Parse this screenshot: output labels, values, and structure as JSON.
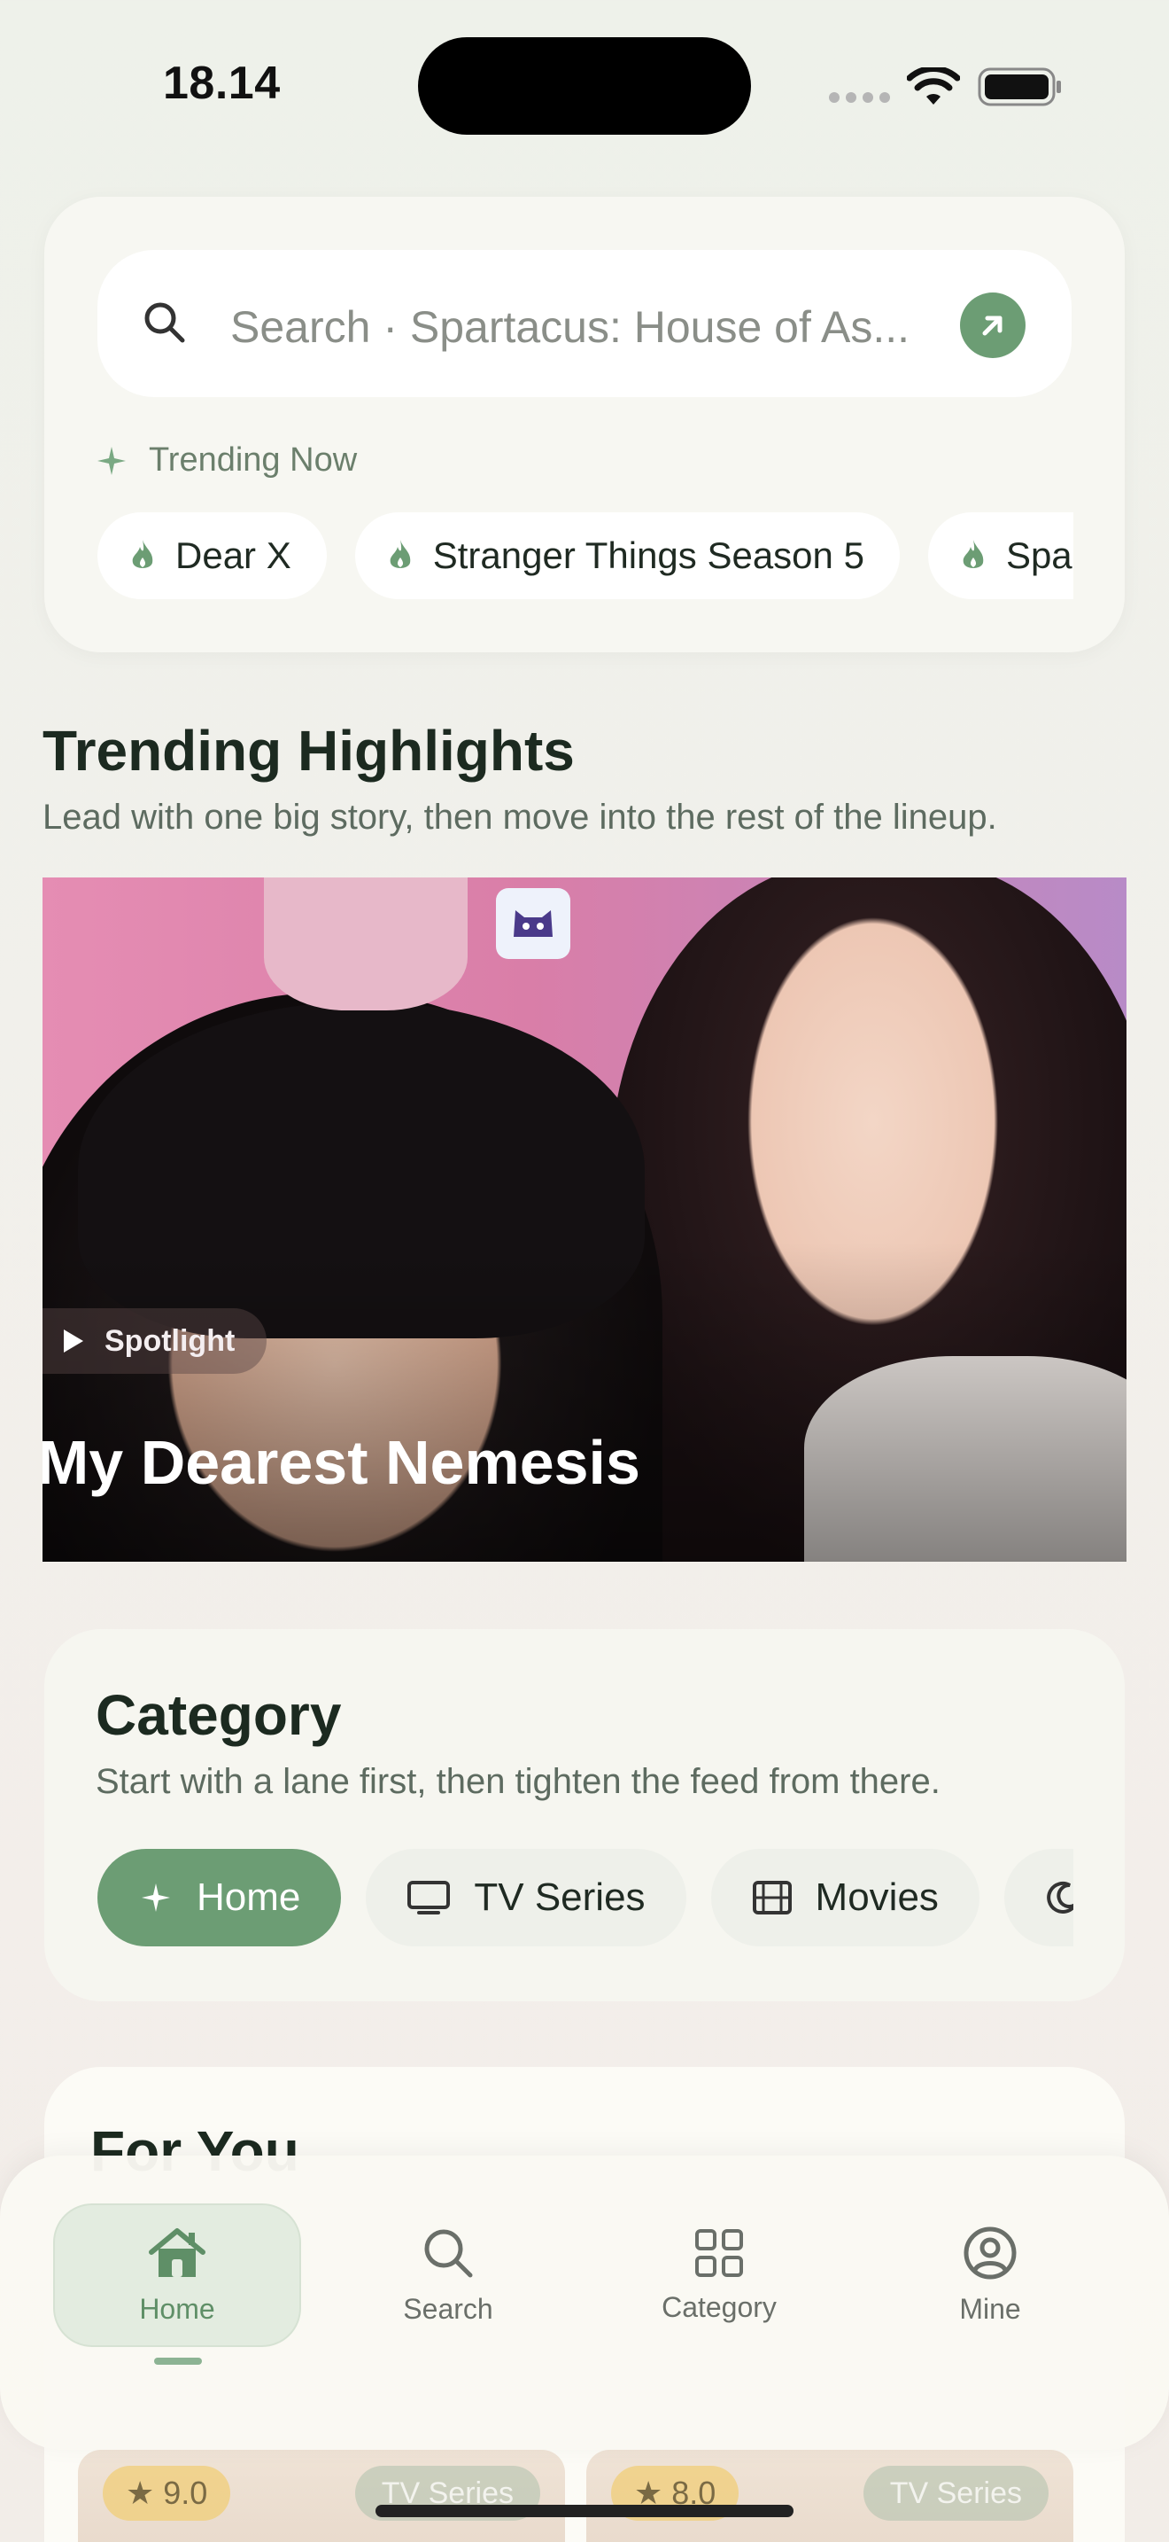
{
  "status_bar": {
    "time": "18.14"
  },
  "search": {
    "placeholder": "Search · Spartacus: House of As...",
    "trending_label": "Trending Now",
    "trending_chips": [
      "Dear X",
      "Stranger Things Season 5",
      "Spartacus"
    ]
  },
  "highlights": {
    "title": "Trending Highlights",
    "subtitle": "Lead with one big story, then move into the rest of the lineup.",
    "hero": {
      "badge": "Spotlight",
      "title": "My Dearest Nemesis"
    }
  },
  "category": {
    "title": "Category",
    "subtitle": "Start with a lane first, then tighten the feed from there.",
    "chips": [
      {
        "label": "Home",
        "icon": "sparkle-icon",
        "active": true
      },
      {
        "label": "TV Series",
        "icon": "tv-icon",
        "active": false
      },
      {
        "label": "Movies",
        "icon": "film-icon",
        "active": false
      },
      {
        "label": "",
        "icon": "moon-icon",
        "active": false
      }
    ]
  },
  "for_you": {
    "title": "For You",
    "items": [
      {
        "rating": "9.0",
        "type": "TV Series"
      },
      {
        "rating": "8.0",
        "type": "TV Series"
      }
    ]
  },
  "tabbar": {
    "tabs": [
      {
        "label": "Home",
        "icon": "home-icon",
        "active": true
      },
      {
        "label": "Search",
        "icon": "search-icon",
        "active": false
      },
      {
        "label": "Category",
        "icon": "grid-icon",
        "active": false
      },
      {
        "label": "Mine",
        "icon": "profile-icon",
        "active": false
      }
    ]
  },
  "colors": {
    "accent": "#6c9d74",
    "background": "#eef1ea",
    "card": "#f8f8f3"
  }
}
